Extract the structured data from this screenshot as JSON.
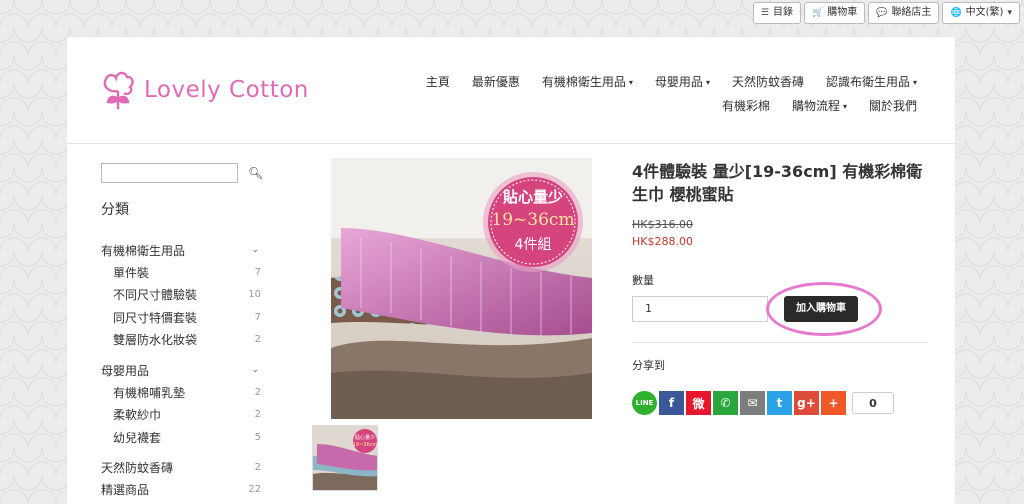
{
  "topbar": {
    "menu_label": "目錄",
    "cart_label": "購物車",
    "contact_label": "聯絡店主",
    "lang_label": "中文(繁)"
  },
  "brand": {
    "name": "Lovely Cotton",
    "color": "#e06bb5"
  },
  "nav": {
    "row1": [
      {
        "label": "主頁",
        "dropdown": false
      },
      {
        "label": "最新優惠",
        "dropdown": false
      },
      {
        "label": "有機棉衛生用品",
        "dropdown": true
      },
      {
        "label": "母嬰用品",
        "dropdown": true
      },
      {
        "label": "天然防蚊香磚",
        "dropdown": false
      },
      {
        "label": "認識布衛生用品",
        "dropdown": true
      }
    ],
    "row2": [
      {
        "label": "有機彩棉",
        "dropdown": false
      },
      {
        "label": "購物流程",
        "dropdown": true
      },
      {
        "label": "關於我們",
        "dropdown": false
      }
    ]
  },
  "sidebar": {
    "search_placeholder": "",
    "category_title": "分類",
    "groups": [
      {
        "label": "有機棉衛生用品",
        "children": [
          {
            "label": "單件裝",
            "count": "7"
          },
          {
            "label": "不同尺寸體驗裝",
            "count": "10"
          },
          {
            "label": "同尺寸特價套裝",
            "count": "7"
          },
          {
            "label": "雙層防水化妝袋",
            "count": "2"
          }
        ]
      },
      {
        "label": "母嬰用品",
        "children": [
          {
            "label": "有機棉哺乳墊",
            "count": "2"
          },
          {
            "label": "柔軟紗巾",
            "count": "2"
          },
          {
            "label": "幼兒襪套",
            "count": "5"
          }
        ]
      }
    ],
    "extra": [
      {
        "label": "天然防蚊香磚",
        "count": "2"
      },
      {
        "label": "精選商品",
        "count": "22"
      }
    ]
  },
  "product": {
    "title": "4件體驗裝 量少[19-36cm] 有機彩棉衛生巾 櫻桃蜜貼",
    "price_old": "HK$316.00",
    "price_new": "HK$288.00",
    "qty_label": "數量",
    "qty_value": "1",
    "add_to_cart": "加入購物車",
    "share_label": "分享到",
    "share_count": "0",
    "badge_line1": "貼心量少",
    "badge_line2": "19~36cm",
    "badge_line3": "4件組",
    "thumb_badge_line1": "貼心量少",
    "thumb_badge_line2": "19~36cm"
  },
  "share_buttons": [
    {
      "name": "line-share-icon",
      "glyph": "LINE",
      "color": "#2fb12f"
    },
    {
      "name": "facebook-share-icon",
      "glyph": "f",
      "color": "#3b5998"
    },
    {
      "name": "weibo-share-icon",
      "glyph": "微",
      "color": "#e6162d"
    },
    {
      "name": "whatsapp-share-icon",
      "glyph": "✆",
      "color": "#2aa63c"
    },
    {
      "name": "email-share-icon",
      "glyph": "✉",
      "color": "#7d7d7d"
    },
    {
      "name": "twitter-share-icon",
      "glyph": "t",
      "color": "#2ca2e6"
    },
    {
      "name": "googleplus-share-icon",
      "glyph": "g+",
      "color": "#dd4b39"
    },
    {
      "name": "more-share-icon",
      "glyph": "+",
      "color": "#f0582a"
    }
  ]
}
